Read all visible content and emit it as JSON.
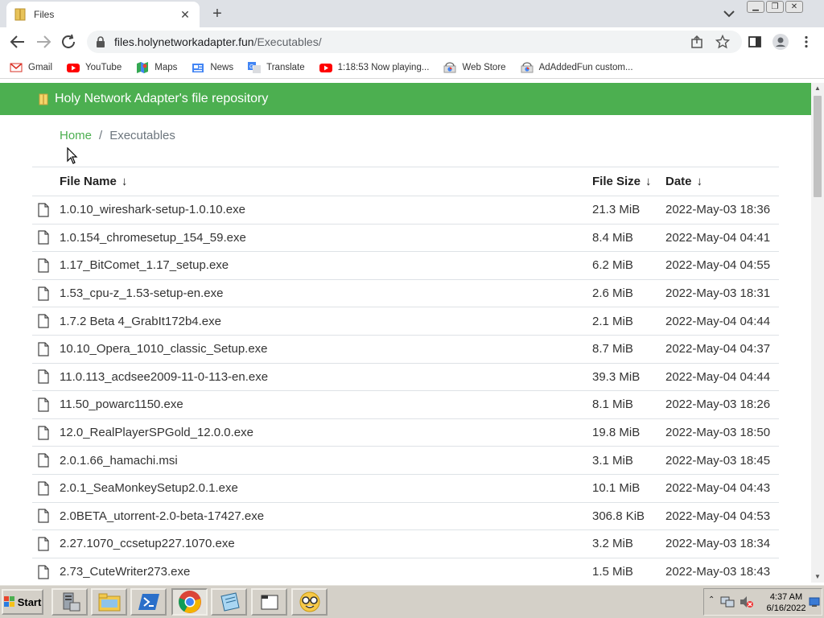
{
  "browser": {
    "tab_title": "Files",
    "tab_close": "✕",
    "new_tab": "+",
    "url_host": "files.holynetworkadapter.fun",
    "url_path": "/Executables/",
    "bookmarks": [
      {
        "label": "Gmail",
        "icon": "gmail-icon"
      },
      {
        "label": "YouTube",
        "icon": "youtube-icon"
      },
      {
        "label": "Maps",
        "icon": "maps-icon"
      },
      {
        "label": "News",
        "icon": "news-icon"
      },
      {
        "label": "Translate",
        "icon": "translate-icon"
      },
      {
        "label": "1:18:53 Now playing...",
        "icon": "youtube-icon"
      },
      {
        "label": "Web Store",
        "icon": "webstore-icon"
      },
      {
        "label": "AdAddedFun custom...",
        "icon": "webstore-icon"
      }
    ]
  },
  "page": {
    "banner_title": "Holy Network Adapter's file repository",
    "breadcrumb": {
      "home": "Home",
      "separator": "/",
      "current": "Executables"
    },
    "columns": {
      "name": "File Name",
      "size": "File Size",
      "date": "Date",
      "sort_arrow": "↓"
    },
    "files": [
      {
        "name": "1.0.10_wireshark-setup-1.0.10.exe",
        "size": "21.3 MiB",
        "date": "2022-May-03 18:36"
      },
      {
        "name": "1.0.154_chromesetup_154_59.exe",
        "size": "8.4 MiB",
        "date": "2022-May-04 04:41"
      },
      {
        "name": "1.17_BitComet_1.17_setup.exe",
        "size": "6.2 MiB",
        "date": "2022-May-04 04:55"
      },
      {
        "name": "1.53_cpu-z_1.53-setup-en.exe",
        "size": "2.6 MiB",
        "date": "2022-May-03 18:31"
      },
      {
        "name": "1.7.2 Beta 4_GrabIt172b4.exe",
        "size": "2.1 MiB",
        "date": "2022-May-04 04:44"
      },
      {
        "name": "10.10_Opera_1010_classic_Setup.exe",
        "size": "8.7 MiB",
        "date": "2022-May-04 04:37"
      },
      {
        "name": "11.0.113_acdsee2009-11-0-113-en.exe",
        "size": "39.3 MiB",
        "date": "2022-May-04 04:44"
      },
      {
        "name": "11.50_powarc1150.exe",
        "size": "8.1 MiB",
        "date": "2022-May-03 18:26"
      },
      {
        "name": "12.0_RealPlayerSPGold_12.0.0.exe",
        "size": "19.8 MiB",
        "date": "2022-May-03 18:50"
      },
      {
        "name": "2.0.1.66_hamachi.msi",
        "size": "3.1 MiB",
        "date": "2022-May-03 18:45"
      },
      {
        "name": "2.0.1_SeaMonkeySetup2.0.1.exe",
        "size": "10.1 MiB",
        "date": "2022-May-04 04:43"
      },
      {
        "name": "2.0BETA_utorrent-2.0-beta-17427.exe",
        "size": "306.8 KiB",
        "date": "2022-May-04 04:53"
      },
      {
        "name": "2.27.1070_ccsetup227.1070.exe",
        "size": "3.2 MiB",
        "date": "2022-May-03 18:34"
      },
      {
        "name": "2.73_CuteWriter273.exe",
        "size": "1.5 MiB",
        "date": "2022-May-03 18:43"
      }
    ]
  },
  "taskbar": {
    "start_label": "Start",
    "time": "4:37 AM",
    "date": "6/16/2022",
    "items": [
      "server-manager-icon",
      "explorer-icon",
      "powershell-icon",
      "chrome-icon",
      "notepad-icon",
      "folder-icon",
      "nerd-face-icon"
    ]
  },
  "colors": {
    "accent": "#4caf50",
    "chrome_bg": "#dee1e6",
    "taskbar_bg": "#d4d0c8"
  }
}
